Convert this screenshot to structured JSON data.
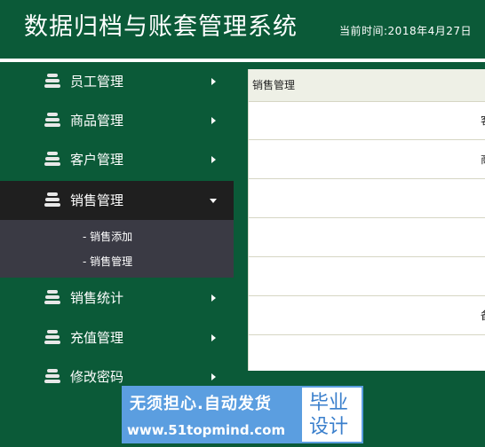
{
  "header": {
    "title": "数据归档与账套管理系统",
    "time": "当前时间:2018年4月27日"
  },
  "sidebar": {
    "items": [
      {
        "label": "员工管理",
        "icon": "stack-icon",
        "arrow": "chevron-right-icon"
      },
      {
        "label": "商品管理",
        "icon": "stack-icon",
        "arrow": "chevron-right-icon"
      },
      {
        "label": "客户管理",
        "icon": "stack-icon",
        "arrow": "chevron-right-icon"
      },
      {
        "label": "销售管理",
        "icon": "stack-icon",
        "arrow": "caret-down-icon",
        "active": true
      },
      {
        "label": "销售统计",
        "icon": "stack-icon",
        "arrow": "chevron-right-icon"
      },
      {
        "label": "充值管理",
        "icon": "stack-icon",
        "arrow": "chevron-right-icon"
      },
      {
        "label": "修改密码",
        "icon": "stack-icon",
        "arrow": "chevron-right-icon"
      }
    ],
    "submenu": [
      {
        "label": "- 销售添加"
      },
      {
        "label": "- 销售管理"
      }
    ]
  },
  "panel": {
    "heading": "销售管理",
    "rows": [
      {
        "text": "客"
      },
      {
        "text": "商"
      },
      {
        "text": ""
      },
      {
        "text": ""
      },
      {
        "text": ""
      },
      {
        "text": "备"
      },
      {
        "text": ""
      }
    ]
  },
  "watermark": {
    "line1": "无须担心.自动发货",
    "line2": "www.51topmind.com",
    "badge_line1": "毕业",
    "badge_line2": "设计"
  },
  "colors": {
    "theme_green": "#0b5a38",
    "active_item": "#1f1f1f",
    "submenu_bg": "#3a3a44",
    "panel_head_bg": "#eef0e6",
    "watermark_blue": "#5b9ee0"
  }
}
